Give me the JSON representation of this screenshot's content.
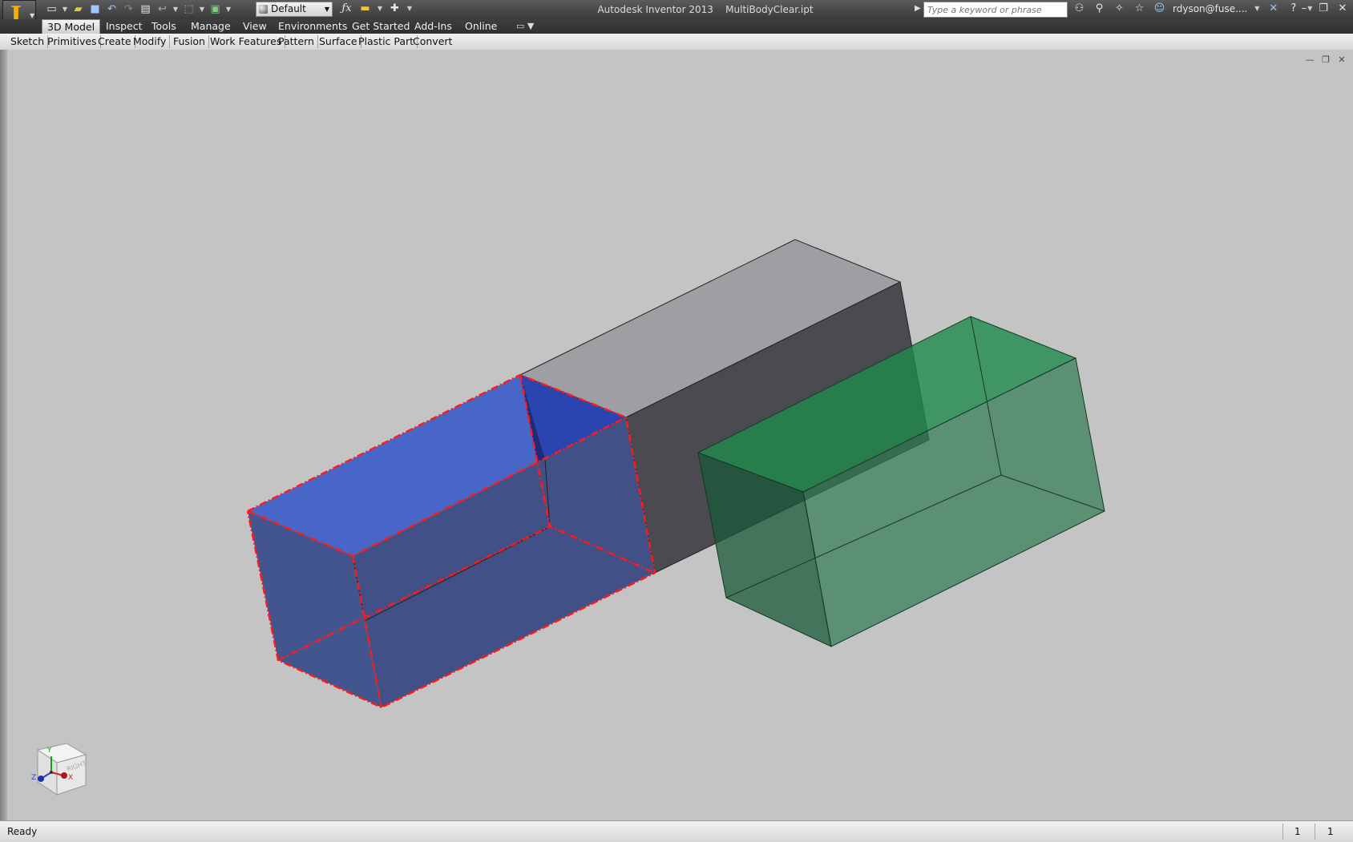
{
  "window": {
    "app_title": "Autodesk Inventor 2013",
    "document_title": "MultiBodyClear.ipt",
    "title_full": "Autodesk Inventor 2013    MultiBodyClear.ipt"
  },
  "quick_access": {
    "appearance_value": "Default",
    "icons": [
      "new-icon",
      "open-icon",
      "save-icon",
      "undo-icon",
      "redo-icon",
      "print-icon",
      "return-icon",
      "select-icon",
      "update-icon"
    ]
  },
  "search": {
    "placeholder": "Type a keyword or phrase"
  },
  "user": {
    "name": "rdyson@fuse...."
  },
  "ribbon": {
    "tabs": [
      "3D Model",
      "Inspect",
      "Tools",
      "Manage",
      "View",
      "Environments",
      "Get Started",
      "Add-Ins",
      "Online"
    ],
    "active_tab": "3D Model",
    "panels": [
      "Sketch",
      "Primitives",
      "Create",
      "Modify",
      "Fusion",
      "Work Features",
      "Pattern",
      "Surface",
      "Plastic Part",
      "Convert"
    ]
  },
  "viewcube": {
    "face_label": "RIGHT",
    "axes": [
      "Y",
      "Z",
      "X"
    ]
  },
  "status": {
    "text": "Ready",
    "count_a": "1",
    "count_b": "1"
  },
  "colors": {
    "viewport_bg": "#c4c4c4",
    "selected_body": "#4466cc",
    "selection_edge": "#ff1a1a",
    "gray_body": "#8e8e93",
    "green_body": "#2e8b57"
  }
}
